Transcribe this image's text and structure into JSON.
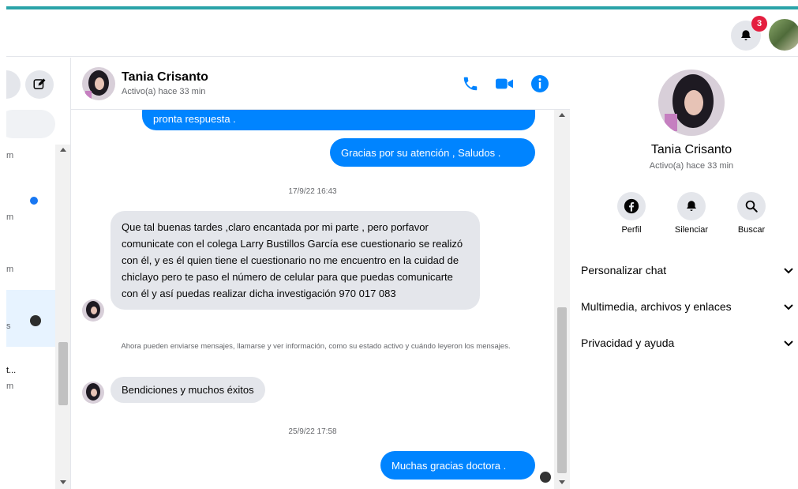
{
  "colors": {
    "accent": "#2aa3a8",
    "outgoing_bubble": "#0084ff",
    "incoming_bubble": "#e4e6eb",
    "badge": "#e41e3f",
    "unread": "#1877f2"
  },
  "topbar": {
    "notification_count": "3",
    "notification_icon": "bell-icon"
  },
  "left_panel": {
    "items": [
      {
        "suffix": "m"
      },
      {
        "suffix": "m"
      },
      {
        "suffix": "m"
      },
      {
        "suffix": "s"
      },
      {
        "title": "t...",
        "suffix": "m"
      }
    ]
  },
  "chat": {
    "name": "Tania Crisanto",
    "status": "Activo(a) hace 33 min",
    "messages": {
      "out_1": "pronta respuesta .",
      "out_2": "Gracias por su atención , Saludos .",
      "time_1": "17/9/22 16:43",
      "in_1": "Que tal buenas tardes ,claro encantada por mi parte , pero porfavor comunicate con el colega Larry Bustillos García ese cuestionario se realizó con él, y es él quien tiene el cuestionario no me encuentro en la cuidad de chiclayo pero te paso el número de celular para que puedas comunicarte con él y así puedas realizar dicha investigación 970 017 083",
      "system": "Ahora pueden enviarse mensajes, llamarse y ver información, como su estado activo y cuándo leyeron los mensajes.",
      "in_2": "Bendiciones y muchos éxitos",
      "time_2": "25/9/22 17:58",
      "out_3": "Muchas gracias doctora ."
    }
  },
  "info": {
    "name": "Tania Crisanto",
    "status": "Activo(a) hace 33 min",
    "actions": {
      "profile": "Perfil",
      "mute": "Silenciar",
      "search": "Buscar"
    },
    "sections": {
      "customize": "Personalizar chat",
      "media": "Multimedia, archivos y enlaces",
      "privacy": "Privacidad y ayuda"
    }
  }
}
